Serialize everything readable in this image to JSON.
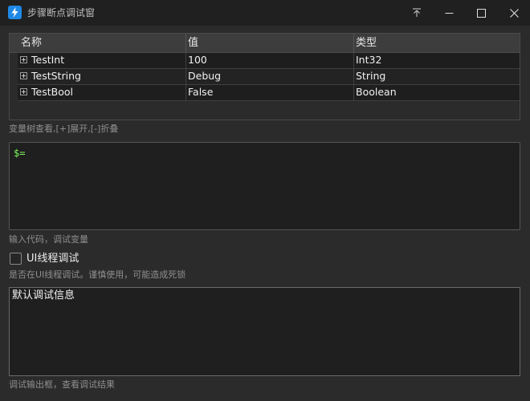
{
  "window": {
    "title": "步骤断点调试窗",
    "accent": "#1e88e5"
  },
  "tree": {
    "columns": [
      "名称",
      "值",
      "类型"
    ],
    "rows": [
      {
        "name": "TestInt",
        "value": "100",
        "type": "Int32"
      },
      {
        "name": "TestString",
        "value": "Debug",
        "type": "String"
      },
      {
        "name": "TestBool",
        "value": "False",
        "type": "Boolean"
      }
    ],
    "hint": "变量树查看,[+]展开,[-]折叠"
  },
  "code": {
    "value": "$=",
    "hint": "输入代码，调试变量"
  },
  "ui_thread": {
    "label": "UI线程调试",
    "checked": false,
    "hint": "是否在UI线程调试。谨慎使用，可能造成死锁"
  },
  "output": {
    "value": "默认调试信息",
    "hint": "调试输出框，查看调试结果"
  }
}
